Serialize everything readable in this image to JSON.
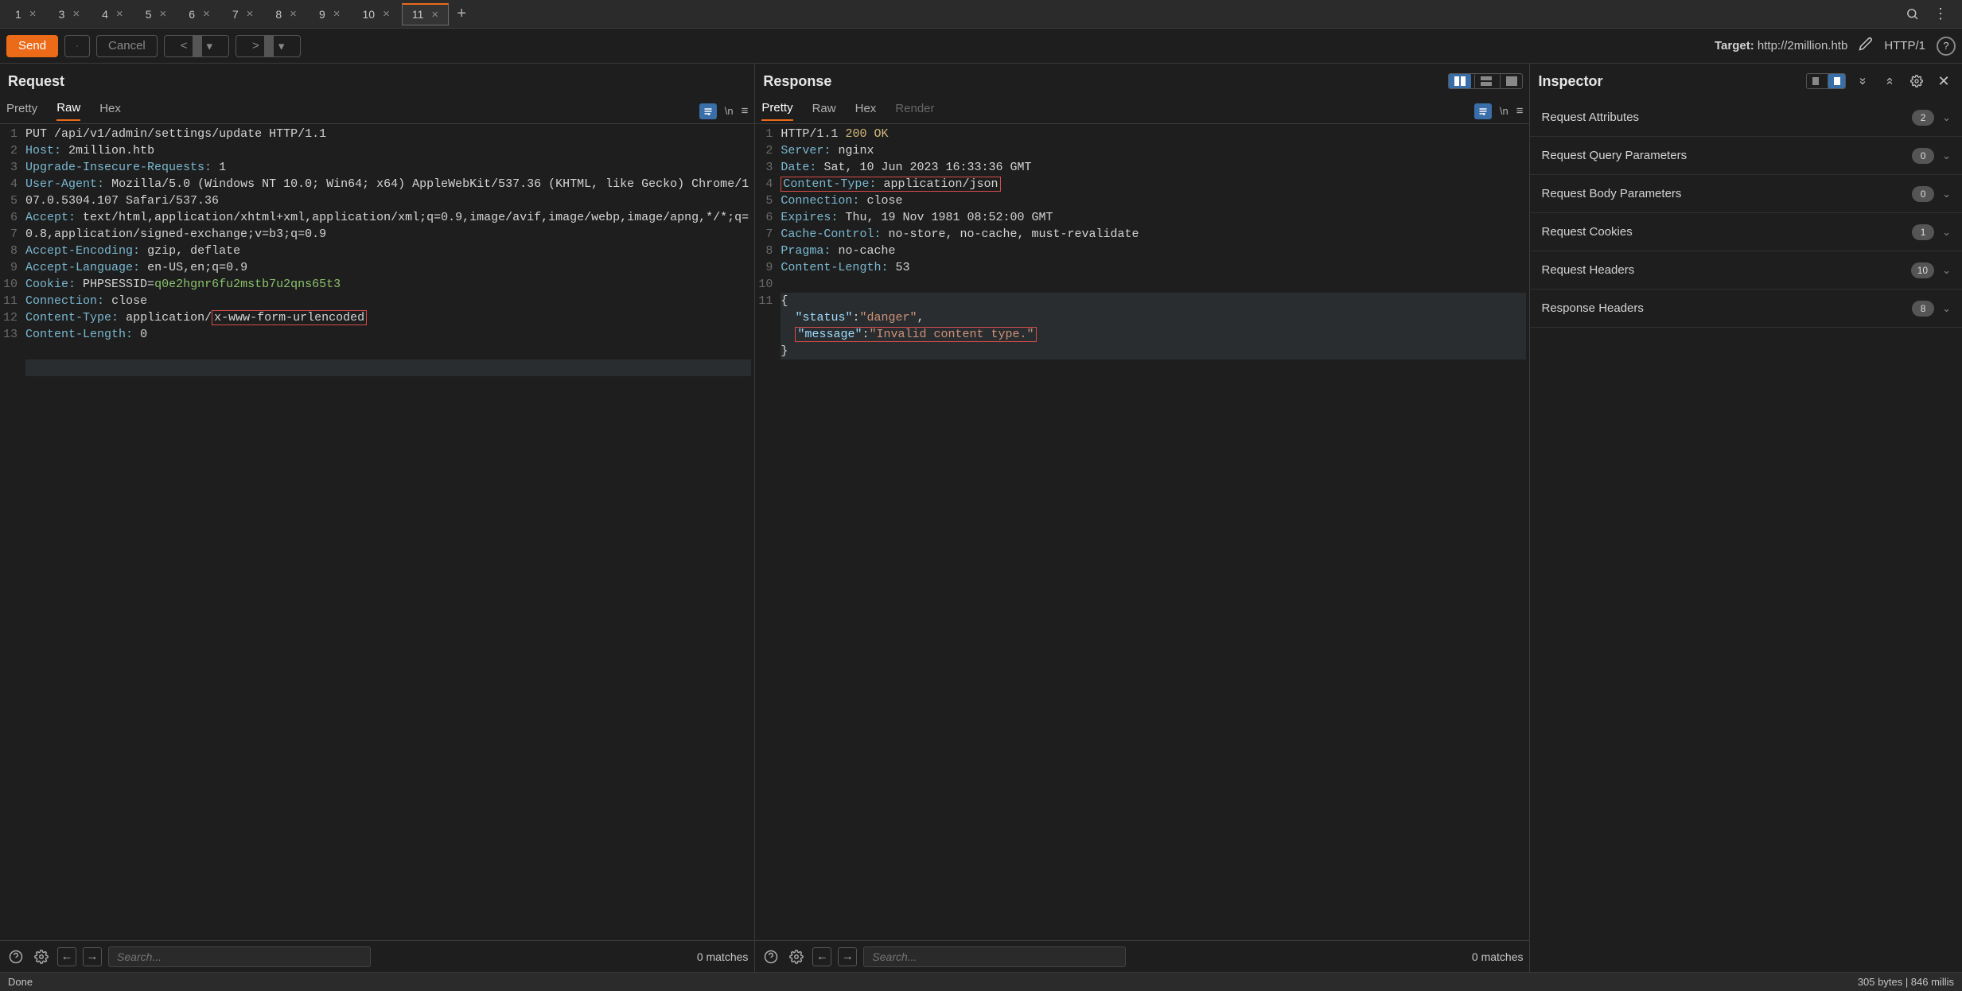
{
  "tabs": {
    "items": [
      {
        "label": "1"
      },
      {
        "label": "3"
      },
      {
        "label": "4"
      },
      {
        "label": "5"
      },
      {
        "label": "6"
      },
      {
        "label": "7"
      },
      {
        "label": "8"
      },
      {
        "label": "9"
      },
      {
        "label": "10"
      },
      {
        "label": "11"
      }
    ],
    "active_index": 9
  },
  "toolbar": {
    "send_label": "Send",
    "cancel_label": "Cancel",
    "target_prefix": "Target: ",
    "target_value": "http://2million.htb",
    "protocol_label": "HTTP/1"
  },
  "request": {
    "title": "Request",
    "tabs": [
      "Pretty",
      "Raw",
      "Hex"
    ],
    "active_tab": 1,
    "lines": [
      {
        "n": 1,
        "html": "<span class='kw'>PUT</span> <span class='url'>/api/v1/admin/settings/update</span> <span class='proto'>HTTP/1.1</span>"
      },
      {
        "n": 2,
        "html": "<span class='hname'>Host:</span> <span class='hval'>2million.htb</span>"
      },
      {
        "n": 3,
        "html": "<span class='hname'>Upgrade-Insecure-Requests:</span> <span class='hval'>1</span>"
      },
      {
        "n": 4,
        "html": "<span class='hname'>User-Agent:</span> <span class='hval'>Mozilla/5.0 (Windows NT 10.0; Win64; x64) AppleWebKit/537.36 (KHTML, like Gecko) Chrome/107.0.5304.107 Safari/537.36</span>"
      },
      {
        "n": 5,
        "html": "<span class='hname'>Accept:</span> <span class='hval'>text/html,application/xhtml+xml,application/xml;q=0.9,image/avif,image/webp,image/apng,*/*;q=0.8,application/signed-exchange;v=b3;q=0.9</span>"
      },
      {
        "n": 6,
        "html": "<span class='hname'>Accept-Encoding:</span> <span class='hval'>gzip, deflate</span>"
      },
      {
        "n": 7,
        "html": "<span class='hname'>Accept-Language:</span> <span class='hval'>en-US,en;q=0.9</span>"
      },
      {
        "n": 8,
        "html": "<span class='hname'>Cookie:</span> <span class='hval'>PHPSESSID=</span><span class='cookie'>q0e2hgnr6fu2mstb7u2qns65t3</span>"
      },
      {
        "n": 9,
        "html": "<span class='hname'>Connection:</span> <span class='hval'>close</span>"
      },
      {
        "n": 10,
        "html": "<span class='hname'>Content-Type:</span> <span class='hval'>application/</span><span class='annot-box'><span class='hval'>x-www-form-urlencoded</span></span>"
      },
      {
        "n": 11,
        "html": "<span class='hname'>Content-Length:</span> <span class='hval'>0</span>"
      },
      {
        "n": 12,
        "html": ""
      },
      {
        "n": 13,
        "html": "",
        "current": true
      }
    ],
    "search_placeholder": "Search...",
    "matches_label": "0 matches"
  },
  "response": {
    "title": "Response",
    "tabs": [
      "Pretty",
      "Raw",
      "Hex",
      "Render"
    ],
    "active_tab": 0,
    "lines": [
      {
        "n": 1,
        "html": "<span class='proto'>HTTP/1.1</span> <span class='num'>200 OK</span>"
      },
      {
        "n": 2,
        "html": "<span class='hname'>Server:</span> <span class='hval'>nginx</span>"
      },
      {
        "n": 3,
        "html": "<span class='hname'>Date:</span> <span class='hval'>Sat, 10 Jun 2023 16:33:36 GMT</span>"
      },
      {
        "n": 4,
        "html": "<span class='annot-box'><span class='hname'>Content-Type:</span> <span class='hval'>application/json</span></span>"
      },
      {
        "n": 5,
        "html": "<span class='hname'>Connection:</span> <span class='hval'>close</span>"
      },
      {
        "n": 6,
        "html": "<span class='hname'>Expires:</span> <span class='hval'>Thu, 19 Nov 1981 08:52:00 GMT</span>"
      },
      {
        "n": 7,
        "html": "<span class='hname'>Cache-Control:</span> <span class='hval'>no-store, no-cache, must-revalidate</span>"
      },
      {
        "n": 8,
        "html": "<span class='hname'>Pragma:</span> <span class='hval'>no-cache</span>"
      },
      {
        "n": 9,
        "html": "<span class='hname'>Content-Length:</span> <span class='hval'>53</span>"
      },
      {
        "n": 10,
        "html": ""
      },
      {
        "n": 11,
        "html": "{",
        "current": true
      },
      {
        "n": "",
        "html": "  <span class='jkey'>\"status\"</span>:<span class='str'>\"danger\"</span>,",
        "current": true
      },
      {
        "n": "",
        "html": "  <span class='annot-box'><span class='jkey'>\"message\"</span>:<span class='str'>\"Invalid content type.\"</span></span>",
        "current": true
      },
      {
        "n": "",
        "html": "}",
        "current": true
      }
    ],
    "search_placeholder": "Search...",
    "matches_label": "0 matches"
  },
  "inspector": {
    "title": "Inspector",
    "rows": [
      {
        "label": "Request Attributes",
        "count": "2"
      },
      {
        "label": "Request Query Parameters",
        "count": "0"
      },
      {
        "label": "Request Body Parameters",
        "count": "0"
      },
      {
        "label": "Request Cookies",
        "count": "1"
      },
      {
        "label": "Request Headers",
        "count": "10"
      },
      {
        "label": "Response Headers",
        "count": "8"
      }
    ]
  },
  "status": {
    "left": "Done",
    "right": "305 bytes | 846 millis"
  }
}
